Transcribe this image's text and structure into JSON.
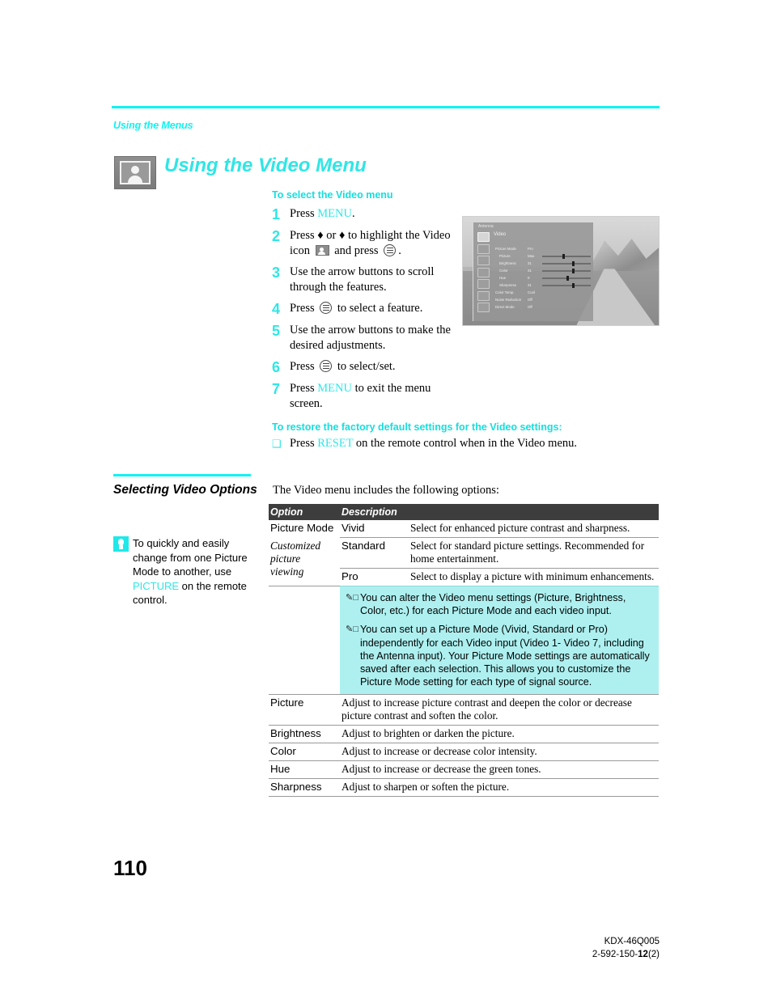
{
  "header": {
    "running_head": "Using the Menus",
    "chapter_title": "Using the Video Menu",
    "chapter_icon": "video-picture-icon"
  },
  "procedure": {
    "heading": "To select the Video menu",
    "steps": [
      {
        "num": "1",
        "pre": "Press ",
        "kw": "MENU",
        "post": "."
      },
      {
        "num": "2",
        "pre": "Press ♦ or ♦ to highlight the Video icon ",
        "kw": "",
        "post": " and press "
      },
      {
        "num": "3",
        "pre": "Use the arrow buttons to scroll through the features.",
        "kw": "",
        "post": ""
      },
      {
        "num": "4",
        "pre": "Press ",
        "kw": "",
        "post": " to select a feature."
      },
      {
        "num": "5",
        "pre": "Use the arrow buttons to make the desired adjustments.",
        "kw": "",
        "post": ""
      },
      {
        "num": "6",
        "pre": "Press ",
        "kw": "",
        "post": " to select/set."
      },
      {
        "num": "7",
        "pre": "Press ",
        "kw": "MENU",
        "post": " to exit the menu screen."
      }
    ],
    "step2_arrow_up": "♦",
    "step2_arrow_down": "♦"
  },
  "restore": {
    "heading": "To restore the factory default settings for the Video settings:",
    "bullet": "❑",
    "pre": "Press ",
    "kw": "RESET",
    "post": " on the remote control when in the Video menu."
  },
  "tv_screenshot": {
    "source_label": "Antenna",
    "menu_label": "Video",
    "rows": [
      {
        "label": "Picture Mode",
        "value": "Pro",
        "bar": false,
        "indent": false
      },
      {
        "label": "Picture",
        "value": "Max",
        "bar": true,
        "fill": 42,
        "indent": true
      },
      {
        "label": "Brightness",
        "value": "31",
        "bar": true,
        "fill": 62,
        "indent": true
      },
      {
        "label": "Color",
        "value": "31",
        "bar": true,
        "fill": 62,
        "indent": true
      },
      {
        "label": "Hue",
        "value": "0",
        "bar": true,
        "fill": 50,
        "indent": true
      },
      {
        "label": "Sharpness",
        "value": "31",
        "bar": true,
        "fill": 62,
        "indent": true
      },
      {
        "label": "Color Temp.",
        "value": "Cool",
        "bar": false,
        "indent": false
      },
      {
        "label": "Noise Reduction",
        "value": "Off",
        "bar": false,
        "indent": false
      },
      {
        "label": "Direct Mode",
        "value": "Off",
        "bar": false,
        "indent": false
      }
    ]
  },
  "sidebar": {
    "heading": "Selecting Video Options",
    "tip_icon": "lightbulb-icon",
    "tip_pre": "To quickly and easily change from one Picture Mode to another, use ",
    "tip_kw": "PICTURE",
    "tip_post": " on the remote control."
  },
  "table": {
    "lead_in": "The Video menu includes the following options:",
    "columns": [
      "Option",
      "Description"
    ],
    "picture_mode": {
      "option": "Picture Mode",
      "sub_lines": [
        "Customized",
        "picture",
        "viewing"
      ],
      "values": [
        {
          "name": "Vivid",
          "desc": "Select for enhanced picture contrast and sharpness."
        },
        {
          "name": "Standard",
          "desc": "Select for standard picture settings. Recommended for home entertainment."
        },
        {
          "name": "Pro",
          "desc": "Select to display a picture with minimum enhancements."
        }
      ]
    },
    "notes": [
      "You can alter the Video menu settings (Picture, Brightness, Color, etc.) for each Picture Mode and each video input.",
      "You can set up a Picture Mode (Vivid, Standard or Pro) independently for each Video input (Video 1- Video 7, including the Antenna input). Your Picture Mode settings are automatically saved after each selection. This allows you to customize the Picture Mode setting for each type of signal source."
    ],
    "note_icon": "pencil-note-icon",
    "rows": [
      {
        "option": "Picture",
        "desc": "Adjust to increase picture contrast and deepen the color or decrease picture contrast and soften the color."
      },
      {
        "option": "Brightness",
        "desc": "Adjust to brighten or darken the picture."
      },
      {
        "option": "Color",
        "desc": "Adjust to increase or decrease color intensity."
      },
      {
        "option": "Hue",
        "desc": "Adjust to increase or decrease the green tones."
      },
      {
        "option": "Sharpness",
        "desc": "Adjust to sharpen or soften the picture."
      }
    ]
  },
  "footer": {
    "page_number": "110",
    "model": "KDX-46Q005",
    "doc_prefix": "2-592-150-",
    "doc_bold": "12",
    "doc_suffix": "(2)"
  },
  "colors": {
    "cyan": "#2fe6e6",
    "cyan_rule": "#0ff3f3",
    "note_bg": "#aef0f0",
    "header_bg": "#3d3d3d"
  }
}
